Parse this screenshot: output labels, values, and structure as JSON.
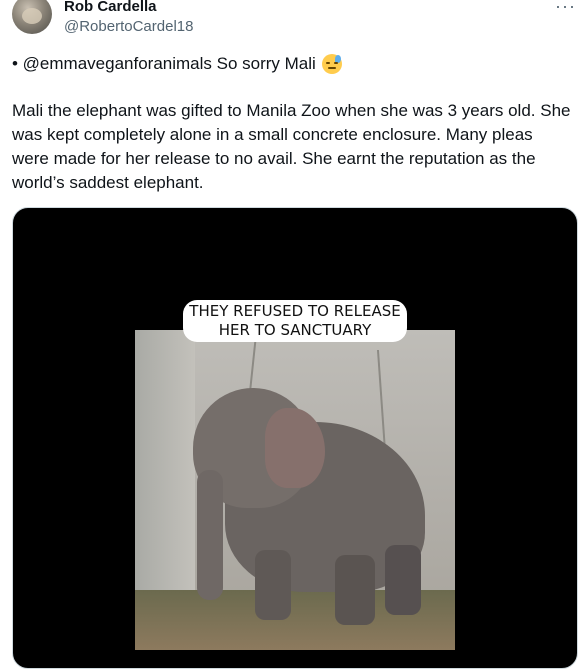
{
  "author": {
    "name": "Rob Cardella",
    "handle": "@RobertoCardel18"
  },
  "more_label": "···",
  "reply_line": "• @emmaveganforanimals So sorry Mali",
  "emoji_name": "downcast-face-with-sweat-emoji",
  "body": "Mali the elephant was gifted to Manila Zoo when she was 3 years old. She was kept completely alone in a small concrete enclosure. Many pleas were made for her release to no avail. She earnt the reputation as the world’s saddest elephant.",
  "video_caption": "THEY REFUSED TO RELEASE HER TO SANCTUARY",
  "colors": {
    "text": "#0f1419",
    "secondary": "#536471",
    "media_bg": "#000000"
  }
}
